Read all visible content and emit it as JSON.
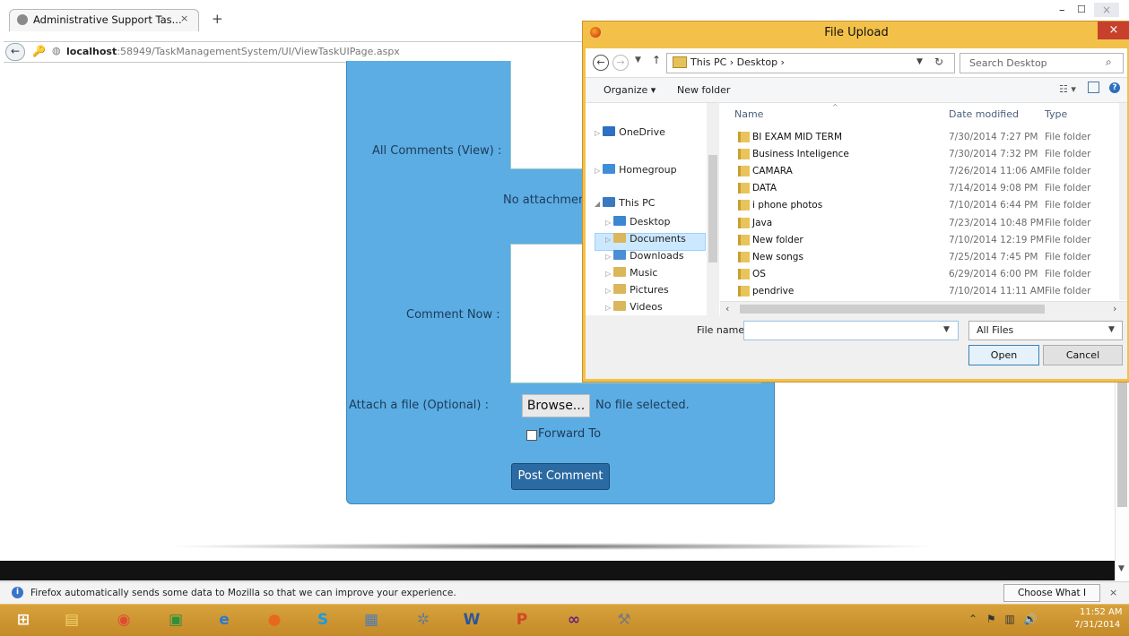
{
  "browser": {
    "tab_title": "Administrative Support Tas...",
    "tab_close": "×",
    "new_tab": "+",
    "url_host": "localhost",
    "url_rest": ":58949/TaskManagementSystem/UI/ViewTaskUIPage.aspx",
    "window_controls": {
      "minimize": "–",
      "maximize": "☐",
      "close": "×"
    }
  },
  "page": {
    "all_comments_label": "All Comments (View) :",
    "no_attachment_text": "No attachment wit",
    "comment_now_label": "Comment Now :",
    "attach_label": "Attach a file (Optional) :",
    "browse_label": "Browse...",
    "no_file_text": "No file selected.",
    "forward_label": "Forward To",
    "post_button": "Post Comment",
    "panel_color": "#5cade3"
  },
  "notification": {
    "text": "Firefox automatically sends some data to Mozilla so that we can improve your experience.",
    "share_button": "Choose What I Share",
    "close": "×"
  },
  "dialog": {
    "title": "File Upload",
    "close": "×",
    "address_path": "This PC  ›  Desktop  ›",
    "search_placeholder": "Search Desktop",
    "organize_label": "Organize ▾",
    "new_folder_label": "New folder",
    "tree": [
      {
        "label": "OneDrive",
        "icon": "onedrive-icon",
        "color": "#2d6fc2"
      },
      {
        "label": "Homegroup",
        "icon": "homegroup-icon",
        "color": "#3e8ed8"
      },
      {
        "label": "This PC",
        "icon": "pc-icon",
        "color": "#3a78c0"
      },
      {
        "label": "Desktop",
        "icon": "desktop-folder-icon",
        "color": "#3d86d1"
      },
      {
        "label": "Documents",
        "icon": "documents-folder-icon",
        "color": "#d9b75a"
      },
      {
        "label": "Downloads",
        "icon": "downloads-folder-icon",
        "color": "#4a8ed6"
      },
      {
        "label": "Music",
        "icon": "music-folder-icon",
        "color": "#d9b75a"
      },
      {
        "label": "Pictures",
        "icon": "pictures-folder-icon",
        "color": "#d9b75a"
      },
      {
        "label": "Videos",
        "icon": "videos-folder-icon",
        "color": "#d9b75a"
      }
    ],
    "columns": {
      "name": "Name",
      "date": "Date modified",
      "type": "Type"
    },
    "files": [
      {
        "name": "BI EXAM MID TERM",
        "date": "7/30/2014 7:27 PM",
        "type": "File folder"
      },
      {
        "name": "Business Inteligence",
        "date": "7/30/2014 7:32 PM",
        "type": "File folder"
      },
      {
        "name": "CAMARA",
        "date": "7/26/2014 11:06 AM",
        "type": "File folder"
      },
      {
        "name": "DATA",
        "date": "7/14/2014 9:08 PM",
        "type": "File folder"
      },
      {
        "name": "i phone photos",
        "date": "7/10/2014 6:44 PM",
        "type": "File folder"
      },
      {
        "name": "Java",
        "date": "7/23/2014 10:48 PM",
        "type": "File folder"
      },
      {
        "name": "New folder",
        "date": "7/10/2014 12:19 PM",
        "type": "File folder"
      },
      {
        "name": "New songs",
        "date": "7/25/2014 7:45 PM",
        "type": "File folder"
      },
      {
        "name": "OS",
        "date": "6/29/2014 6:00 PM",
        "type": "File folder"
      },
      {
        "name": "pendrive",
        "date": "7/10/2014 11:11 AM",
        "type": "File folder"
      }
    ],
    "file_name_label": "File name:",
    "file_name_value": "",
    "file_type": "All Files",
    "open_button": "Open",
    "cancel_button": "Cancel"
  },
  "taskbar": {
    "apps": [
      {
        "name": "start-icon",
        "glyph": "⊞",
        "color": "#ffffff"
      },
      {
        "name": "file-explorer-icon",
        "glyph": "▤",
        "color": "#f2d36a"
      },
      {
        "name": "chrome-icon",
        "glyph": "◉",
        "color": "#e04b33"
      },
      {
        "name": "store-icon",
        "glyph": "▣",
        "color": "#2f8f3a"
      },
      {
        "name": "internet-explorer-icon",
        "glyph": "e",
        "color": "#2a79d2"
      },
      {
        "name": "firefox-icon",
        "glyph": "●",
        "color": "#e76a1c"
      },
      {
        "name": "skype-icon",
        "glyph": "S",
        "color": "#1a9be0"
      },
      {
        "name": "control-panel-icon",
        "glyph": "▦",
        "color": "#4f7db5"
      },
      {
        "name": "settings-icon",
        "glyph": "✲",
        "color": "#6f7c8a"
      },
      {
        "name": "word-icon",
        "glyph": "W",
        "color": "#2b579a"
      },
      {
        "name": "powerpoint-icon",
        "glyph": "P",
        "color": "#d24726"
      },
      {
        "name": "visual-studio-icon",
        "glyph": "∞",
        "color": "#68217a"
      },
      {
        "name": "tools-icon",
        "glyph": "⚒",
        "color": "#7a7a7a"
      }
    ],
    "time": "11:52 AM",
    "date": "7/31/2014"
  }
}
